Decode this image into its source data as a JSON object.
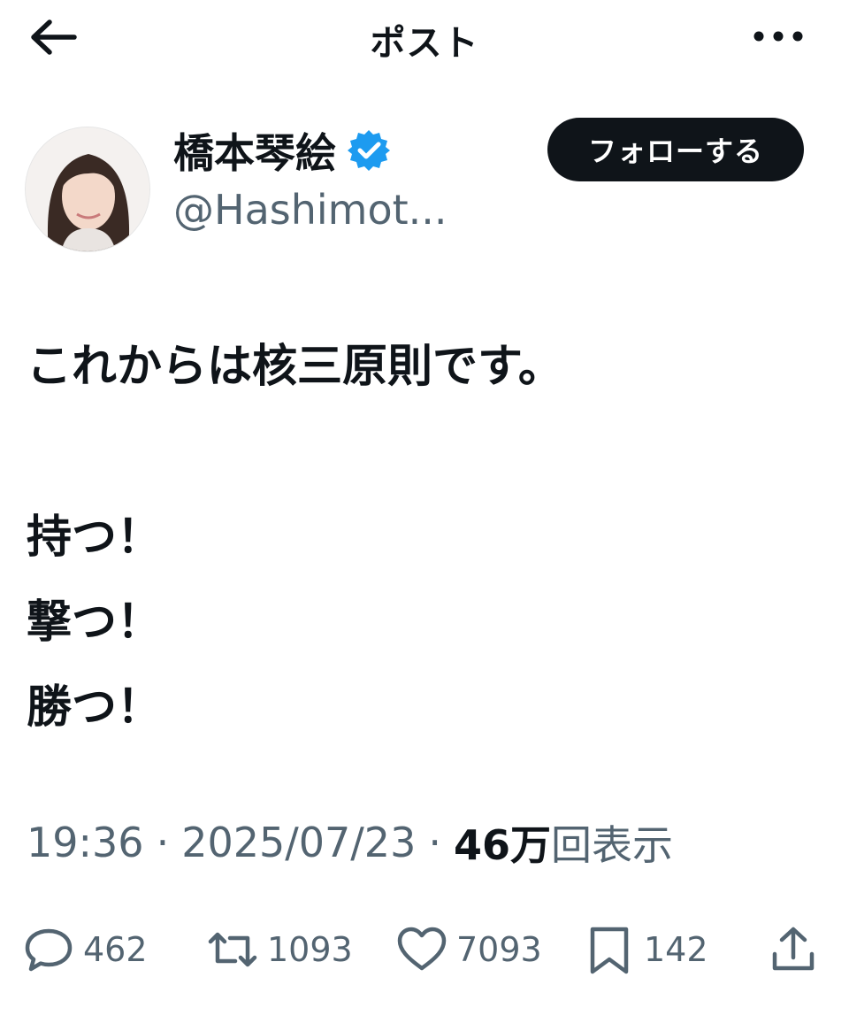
{
  "header": {
    "title": "ポスト",
    "back_icon": "arrow-left-icon",
    "more_icon": "more-horizontal-icon"
  },
  "author": {
    "name": "橋本琴絵",
    "handle": "@Hashimot...",
    "verified": true,
    "verified_color": "#1d9bf0",
    "follow_label": "フォローする"
  },
  "post": {
    "lines": [
      "これからは核三原則です。",
      "持つ！",
      "撃つ！",
      "勝つ！"
    ]
  },
  "meta": {
    "time": "19:36",
    "separator": "·",
    "date": "2025/07/23",
    "views_count": "46万",
    "views_label": "回表示"
  },
  "actions": {
    "replies": {
      "icon": "reply-icon",
      "count": "462"
    },
    "reposts": {
      "icon": "repost-icon",
      "count": "1093"
    },
    "likes": {
      "icon": "heart-icon",
      "count": "7093"
    },
    "bookmarks": {
      "icon": "bookmark-icon",
      "count": "142"
    },
    "share": {
      "icon": "share-icon"
    }
  },
  "colors": {
    "text": "#0f1419",
    "secondary": "#536471",
    "accent": "#1d9bf0"
  }
}
